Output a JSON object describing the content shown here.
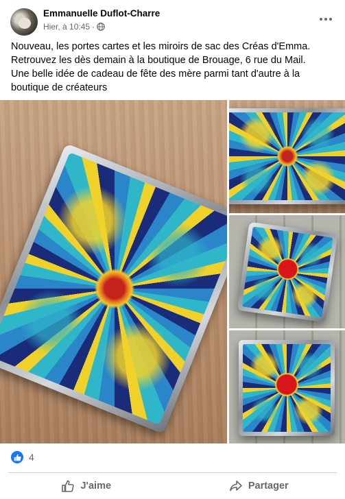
{
  "post": {
    "author": "Emmanuelle Duflot-Charre",
    "timestamp": "Hier, à 10:45",
    "separator": "·",
    "text": [
      "Nouveau, les portes cartes et les miroirs de sac des Créas d'Emma.",
      "Retrouvez les dès demain à la boutique de Brouage, 6 rue du Mail.",
      "Une belle idée de cadeau de fête des mère parmi tant d'autre à la boutique de créateurs"
    ]
  },
  "reactions": {
    "count": "4"
  },
  "actions": {
    "like_label": "J'aime",
    "share_label": "Partager"
  },
  "icons": {
    "globe": "globe-icon",
    "more": "more-icon",
    "like_badge": "like-badge-icon",
    "like": "thumbs-up-icon",
    "share": "share-icon"
  },
  "colors": {
    "accent": "#1877f2",
    "secondary_text": "#65676b",
    "primary_text": "#050505"
  }
}
